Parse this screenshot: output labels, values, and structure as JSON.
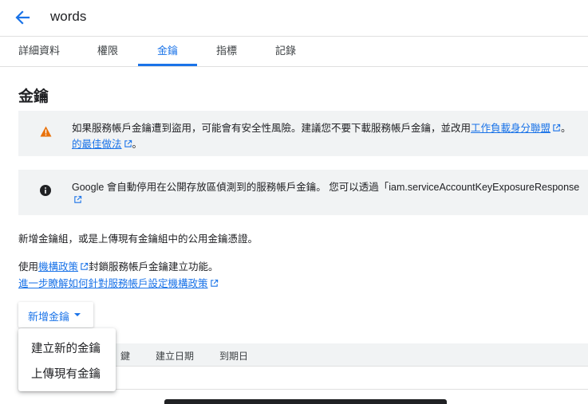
{
  "header": {
    "title": "words"
  },
  "tabs": [
    {
      "label": "詳細資料"
    },
    {
      "label": "權限"
    },
    {
      "label": "金鑰"
    },
    {
      "label": "指標"
    },
    {
      "label": "記錄"
    }
  ],
  "section": {
    "title": "金鑰"
  },
  "banner_warning": {
    "line1": "如果服務帳戶金鑰遭到盜用，可能會有安全性風險。建議您不要下載服務帳戶金鑰，並改用",
    "link1": "工作負載身分聯盟",
    "line1_tail": "。",
    "link2": "的最佳做法",
    "line2_tail": "。"
  },
  "banner_info": {
    "line1": "Google 會自動停用在公開存放區偵測到的服務帳戶金鑰。 您可以透過「iam.serviceAccountKeyExposureResponse"
  },
  "paragraphs": {
    "p1": "新增金鑰組，或是上傳現有金鑰組中的公用金鑰憑證。",
    "p2_pre": "使用",
    "p2_link": "機構政策",
    "p2_post": "封鎖服務帳戶金鑰建立功能。",
    "p3_link": "進一步瞭解如何針對服務帳戶設定機構政策"
  },
  "add_key_button": {
    "label": "新增金鑰"
  },
  "table": {
    "headers": [
      "鍵",
      "建立日期",
      "到期日"
    ]
  },
  "dropdown_menu": {
    "items": [
      "建立新的金鑰",
      "上傳現有金鑰"
    ]
  },
  "colors": {
    "accent": "#1a73e8",
    "warning": "#e8710a",
    "banner_bg": "#f1f3f4"
  }
}
